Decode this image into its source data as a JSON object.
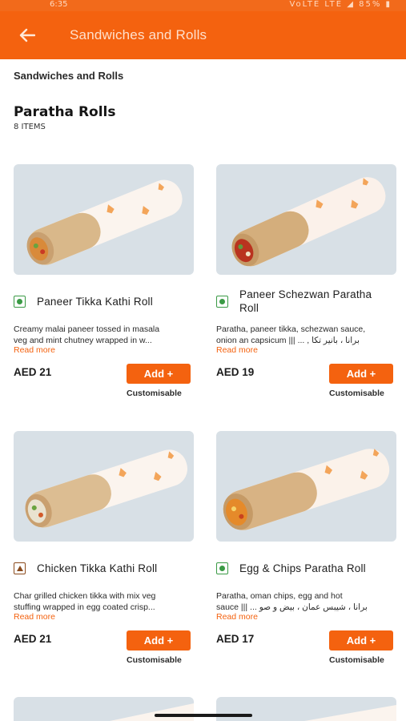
{
  "status_bar": {
    "time": "6:35",
    "icons": "VoLTE  LTE  ◢  85% ▮"
  },
  "header": {
    "title": "Sandwiches and Rolls"
  },
  "breadcrumb": "Sandwiches and Rolls",
  "section": {
    "title": "Paratha Rolls",
    "count": "8 ITEMS"
  },
  "colors": {
    "accent": "#f4620f",
    "veg": "#3a9a45",
    "nonveg": "#8a4a1c"
  },
  "items": [
    {
      "name": "Paneer Tikka Kathi Roll",
      "desc1": "Creamy malai paneer tossed in masala",
      "desc2": "veg and mint chutney wrapped in w...",
      "read_more": "Read more",
      "price": "AED 21",
      "add": "Add +",
      "custom": "Customisable",
      "type": "veg"
    },
    {
      "name": "Paneer Schezwan Paratha",
      "name2": "Roll",
      "desc1": "Paratha, paneer tikka, schezwan sauce,",
      "desc2": "onion an capsicum ||| ... , برانا ، بانير تكا",
      "read_more": "Read more",
      "price": "AED 19",
      "add": "Add +",
      "custom": "Customisable",
      "type": "veg"
    },
    {
      "name": "Chicken Tikka Kathi Roll",
      "desc1": "Char grilled chicken tikka with mix veg",
      "desc2": "stuffing wrapped in egg coated crisp...",
      "read_more": "Read more",
      "price": "AED 21",
      "add": "Add +",
      "custom": "Customisable",
      "type": "nonveg"
    },
    {
      "name": "Egg & Chips Paratha Roll",
      "desc1": "Paratha, oman chips, egg and hot",
      "desc2": "sauce ||| ... برانا ، شيبس عمان ، بيض و صو",
      "read_more": "Read more",
      "price": "AED 17",
      "add": "Add +",
      "custom": "Customisable",
      "type": "veg"
    }
  ]
}
